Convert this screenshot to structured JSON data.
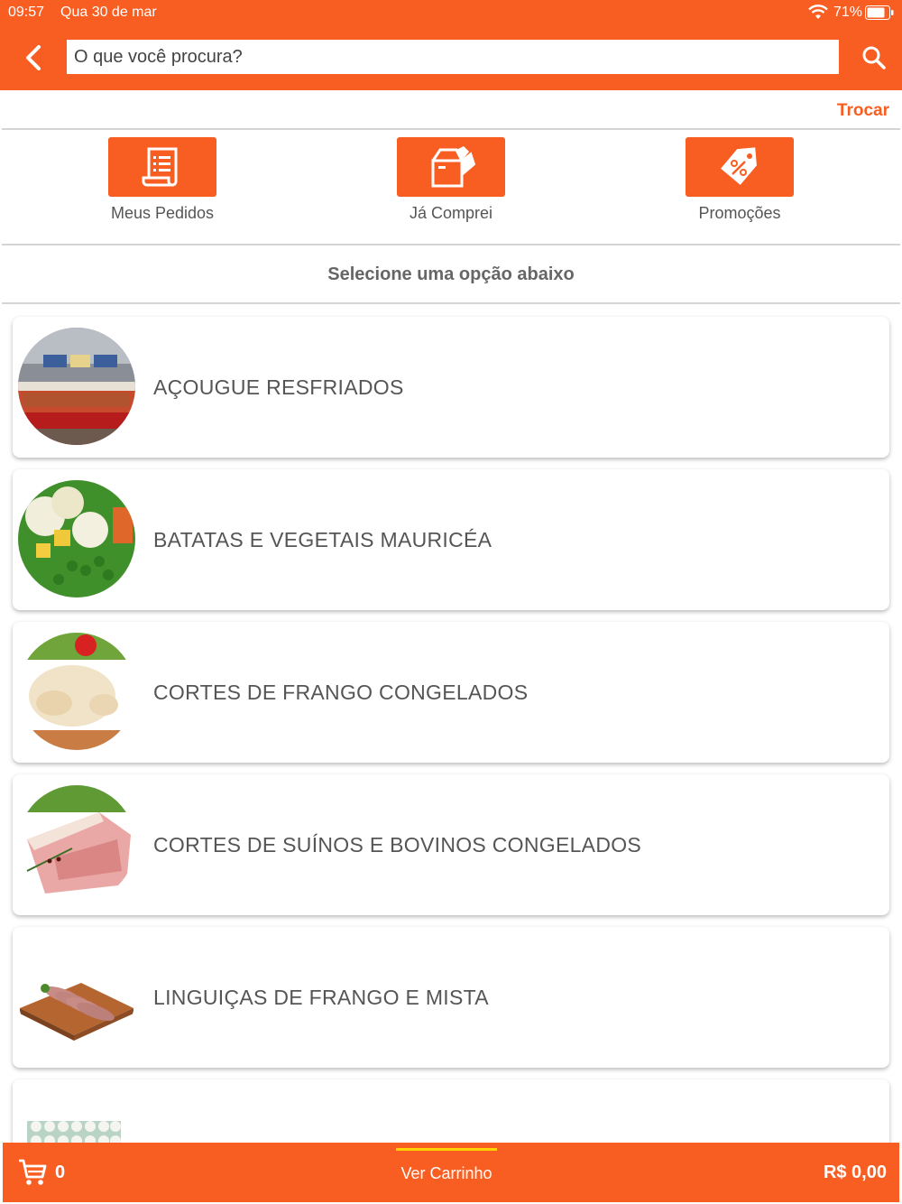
{
  "status": {
    "time": "09:57",
    "date": "Qua 30 de mar",
    "battery": "71%"
  },
  "search": {
    "placeholder": "O que você procura?"
  },
  "store": {
    "change_label": "Trocar"
  },
  "quick_actions": [
    {
      "label": "Meus Pedidos",
      "icon": "receipt-icon"
    },
    {
      "label": "Já Comprei",
      "icon": "box-icon"
    },
    {
      "label": "Promoções",
      "icon": "discount-tag-icon"
    }
  ],
  "section_title": "Selecione uma opção abaixo",
  "categories": [
    {
      "name": "AÇOUGUE RESFRIADOS"
    },
    {
      "name": "BATATAS E VEGETAIS MAURICÉA"
    },
    {
      "name": "CORTES DE FRANGO CONGELADOS"
    },
    {
      "name": "CORTES DE SUÍNOS E BOVINOS CONGELADOS"
    },
    {
      "name": "LINGUIÇAS DE FRANGO E MISTA"
    },
    {
      "name": ""
    }
  ],
  "cart": {
    "count": "0",
    "view_label": "Ver Carrinho",
    "total": "R$ 0,00"
  },
  "colors": {
    "accent": "#f85e22",
    "highlight": "#ffd200"
  }
}
